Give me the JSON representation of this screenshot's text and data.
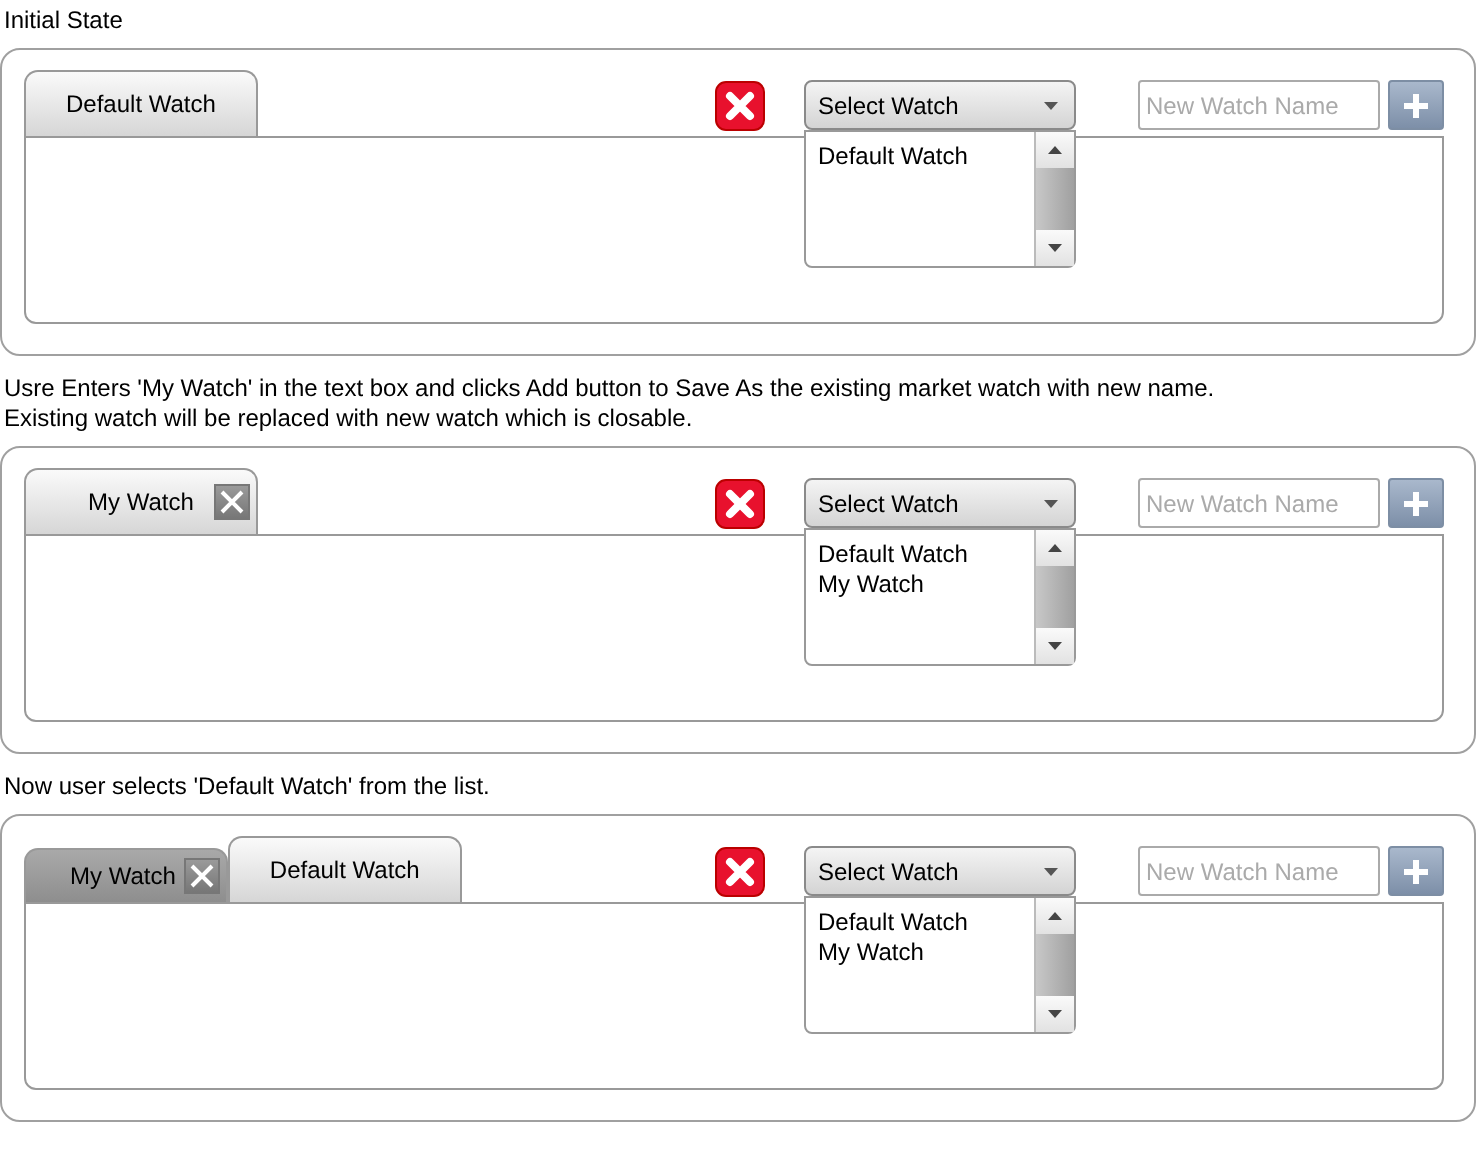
{
  "scenarios": [
    {
      "caption": [
        "Initial State"
      ],
      "tabs": [
        {
          "label": "Default Watch",
          "selected": true,
          "closable": false
        }
      ],
      "select": {
        "label": "Select Watch",
        "options": [
          "Default Watch"
        ]
      },
      "name_field": {
        "placeholder": "New Watch Name"
      }
    },
    {
      "caption": [
        "Usre Enters 'My Watch' in the text box and clicks Add button to Save As the existing market watch with new name.",
        "Existing watch will be replaced with new watch which is closable."
      ],
      "tabs": [
        {
          "label": "My Watch",
          "selected": true,
          "closable": true
        }
      ],
      "select": {
        "label": "Select Watch",
        "options": [
          "Default Watch",
          "My Watch"
        ]
      },
      "name_field": {
        "placeholder": "New Watch Name"
      }
    },
    {
      "caption": [
        "Now user selects 'Default Watch' from the list."
      ],
      "tabs": [
        {
          "label": "My Watch",
          "selected": false,
          "closable": true
        },
        {
          "label": "Default Watch",
          "selected": true,
          "closable": false
        }
      ],
      "select": {
        "label": "Select Watch",
        "options": [
          "Default Watch",
          "My Watch"
        ]
      },
      "name_field": {
        "placeholder": "New Watch Name"
      }
    }
  ]
}
